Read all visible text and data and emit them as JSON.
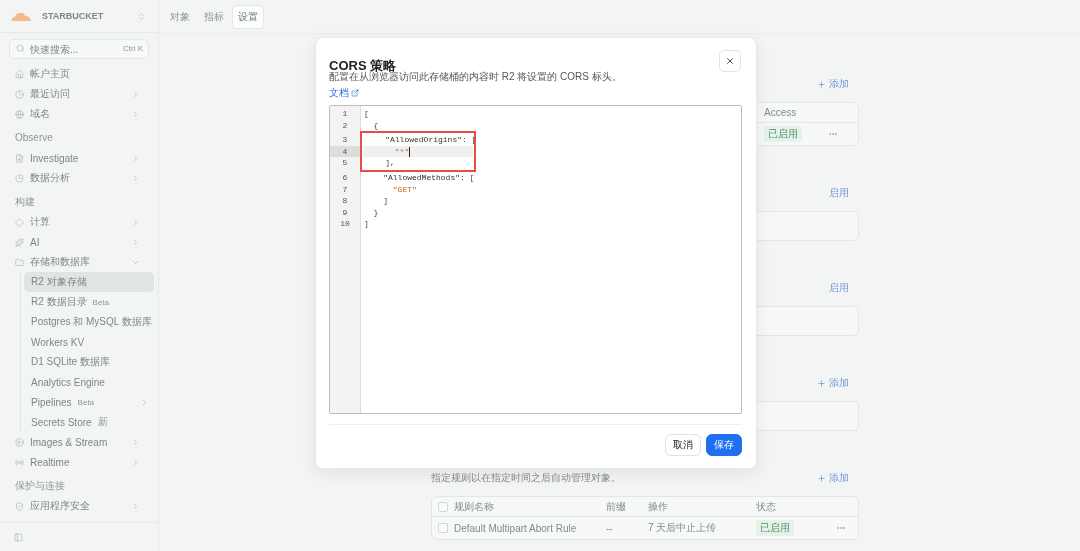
{
  "account": {
    "name": "STARBUCKET"
  },
  "sidebar": {
    "search": {
      "placeholder": "快速搜索...",
      "shortcut": "Ctrl K"
    },
    "sections": [
      {
        "items": [
          {
            "label": "帐户主页",
            "expandable": false,
            "selected": false
          },
          {
            "label": "最近访问",
            "expandable": true,
            "expanded": false,
            "selected": false
          },
          {
            "label": "域名",
            "expandable": true,
            "expanded": false,
            "selected": false
          }
        ]
      },
      {
        "title": "Observe",
        "items": [
          {
            "label": "Investigate",
            "expandable": true,
            "expanded": false,
            "selected": false
          },
          {
            "label": "数据分析",
            "expandable": true,
            "expanded": false,
            "selected": false
          }
        ]
      },
      {
        "title": "构建",
        "items": [
          {
            "label": "计算",
            "expandable": true,
            "expanded": false,
            "selected": false
          },
          {
            "label": "AI",
            "expandable": true,
            "expanded": false,
            "selected": false
          },
          {
            "label": "存储和数据库",
            "expandable": true,
            "expanded": true,
            "selected": false,
            "children": [
              {
                "label": "R2 对象存储",
                "expandable": false,
                "selected": true
              },
              {
                "label": "R2 数据目录",
                "badge": "Beta",
                "expandable": false,
                "selected": false
              },
              {
                "label": "Postgres 和 MySQL 数据库",
                "expandable": false,
                "selected": false
              },
              {
                "label": "Workers KV",
                "expandable": false,
                "selected": false
              },
              {
                "label": "D1 SQLite 数据库",
                "expandable": false,
                "selected": false
              },
              {
                "label": "Analytics Engine",
                "expandable": false,
                "selected": false
              },
              {
                "label": "Pipelines",
                "badge": "Beta",
                "expandable": true,
                "expanded": false,
                "selected": false
              },
              {
                "label": "Secrets Store",
                "badge": "新",
                "expandable": false,
                "selected": false
              }
            ]
          },
          {
            "label": "Images & Stream",
            "expandable": true,
            "expanded": false,
            "selected": false
          },
          {
            "label": "Realtime",
            "expandable": true,
            "expanded": false,
            "selected": false
          }
        ]
      },
      {
        "title": "保护与连接",
        "items": [
          {
            "label": "应用程序安全",
            "expandable": true,
            "expanded": false,
            "selected": false
          }
        ]
      }
    ]
  },
  "tabs": [
    {
      "label": "对象",
      "selected": false
    },
    {
      "label": "指标",
      "selected": false
    },
    {
      "label": "设置",
      "selected": true
    }
  ],
  "sections": [
    {
      "action": {
        "kind": "add",
        "label": "添加"
      },
      "card": {
        "kind": "access_table",
        "columns": [
          "Access"
        ],
        "rows": [
          {
            "status": "已启用"
          }
        ]
      }
    },
    {
      "action": {
        "kind": "plain",
        "label": "启用"
      },
      "card": {
        "kind": "empty"
      }
    },
    {
      "action": {
        "kind": "plain",
        "label": "启用"
      },
      "card": {
        "kind": "empty"
      }
    },
    {
      "action": {
        "kind": "add",
        "label": "添加"
      },
      "card": {
        "kind": "empty"
      }
    },
    {
      "description": "指定规则以在指定时间之后自动管理对象。",
      "action": {
        "kind": "add",
        "label": "添加"
      },
      "card": {
        "kind": "rules_table",
        "checked": false,
        "columns": [
          "规则名称",
          "前缀",
          "操作",
          "状态"
        ],
        "rows": [
          {
            "checked": false,
            "name": "Default Multipart Abort Rule",
            "prefix": "--",
            "action": "7 天后中止上传",
            "status": "已启用"
          }
        ]
      }
    }
  ],
  "dialog": {
    "title": "CORS 策略",
    "description": "配置在从浏览器访问此存储桶的内容时 R2 将设置的 CORS 标头。",
    "link": "文档",
    "editor": {
      "lines": [
        {
          "number": "1",
          "selected": false,
          "highlighted": false,
          "parts": [
            {
              "kind": "punct",
              "text": "["
            }
          ]
        },
        {
          "number": "2",
          "selected": false,
          "highlighted": false,
          "parts": [
            {
              "kind": "punct",
              "text": "  {"
            }
          ]
        },
        {
          "number": "3",
          "selected": false,
          "highlighted": true,
          "parts": [
            {
              "kind": "key",
              "text": "    \"AllowedOrigins\""
            },
            {
              "kind": "punct",
              "text": ": ["
            }
          ]
        },
        {
          "number": "4",
          "selected": true,
          "highlighted": true,
          "parts": [
            {
              "kind": "string",
              "text": "      \"*\""
            }
          ]
        },
        {
          "number": "5",
          "selected": false,
          "highlighted": true,
          "parts": [
            {
              "kind": "punct",
              "text": "    ],"
            }
          ]
        },
        {
          "number": "6",
          "selected": false,
          "highlighted": false,
          "parts": [
            {
              "kind": "key",
              "text": "    \"AllowedMethods\""
            },
            {
              "kind": "punct",
              "text": ": ["
            }
          ]
        },
        {
          "number": "7",
          "selected": false,
          "highlighted": false,
          "parts": [
            {
              "kind": "string",
              "text": "      \"GET\""
            }
          ]
        },
        {
          "number": "8",
          "selected": false,
          "highlighted": false,
          "parts": [
            {
              "kind": "punct",
              "text": "    ]"
            }
          ]
        },
        {
          "number": "9",
          "selected": false,
          "highlighted": false,
          "parts": [
            {
              "kind": "punct",
              "text": "  }"
            }
          ]
        },
        {
          "number": "10",
          "selected": false,
          "highlighted": false,
          "parts": [
            {
              "kind": "punct",
              "text": "]"
            }
          ]
        }
      ]
    },
    "buttons": [
      {
        "kind": "secondary",
        "label": "取消"
      },
      {
        "kind": "primary",
        "label": "保存"
      }
    ]
  }
}
